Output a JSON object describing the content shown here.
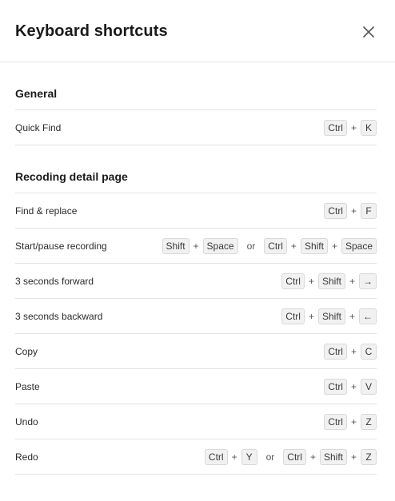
{
  "dialog": {
    "title": "Keyboard shortcuts",
    "close_icon": "close-icon"
  },
  "sections": [
    {
      "title": "General",
      "rows": [
        {
          "label": "Quick Find",
          "combos": [
            [
              "Ctrl",
              "K"
            ]
          ]
        }
      ]
    },
    {
      "title": "Recoding detail page",
      "rows": [
        {
          "label": "Find & replace",
          "combos": [
            [
              "Ctrl",
              "F"
            ]
          ]
        },
        {
          "label": "Start/pause recording",
          "combos": [
            [
              "Shift",
              "Space"
            ],
            [
              "Ctrl",
              "Shift",
              "Space"
            ]
          ]
        },
        {
          "label": "3 seconds forward",
          "combos": [
            [
              "Ctrl",
              "Shift",
              "→"
            ]
          ]
        },
        {
          "label": "3 seconds backward",
          "combos": [
            [
              "Ctrl",
              "Shift",
              "←"
            ]
          ]
        },
        {
          "label": "Copy",
          "combos": [
            [
              "Ctrl",
              "C"
            ]
          ]
        },
        {
          "label": "Paste",
          "combos": [
            [
              "Ctrl",
              "V"
            ]
          ]
        },
        {
          "label": "Undo",
          "combos": [
            [
              "Ctrl",
              "Z"
            ]
          ]
        },
        {
          "label": "Redo",
          "combos": [
            [
              "Ctrl",
              "Y"
            ],
            [
              "Ctrl",
              "Shift",
              "Z"
            ]
          ]
        }
      ]
    }
  ],
  "symbols": {
    "plus": "+",
    "or": "or"
  }
}
